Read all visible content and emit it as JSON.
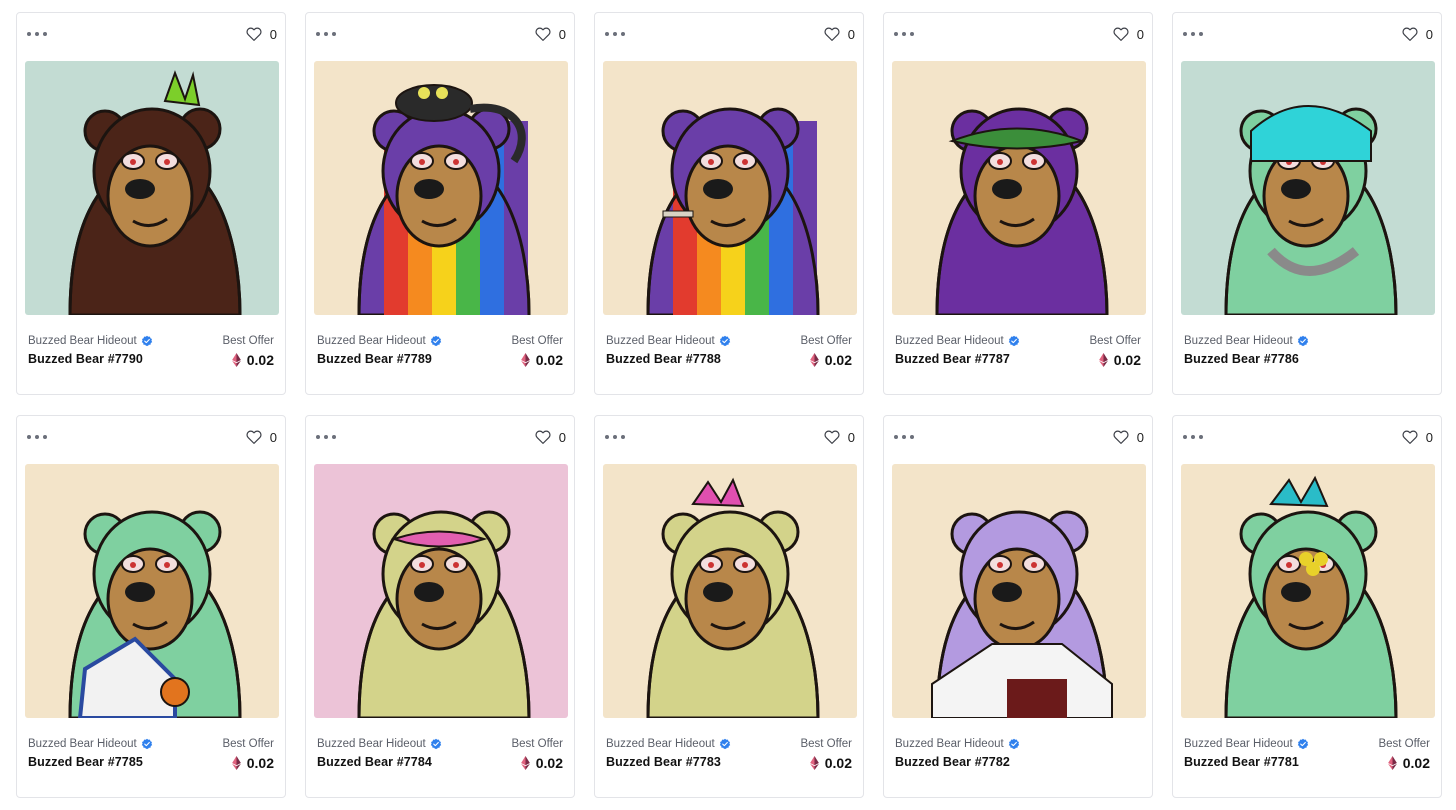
{
  "cards": [
    {
      "collection": "Buzzed Bear Hideout",
      "name": "Buzzed Bear #7790",
      "likes": "0",
      "offer_label": "Best Offer",
      "price": "0.02",
      "bg": "#c3dcd3",
      "fur": "#4b2418",
      "trait": "green-mohawk"
    },
    {
      "collection": "Buzzed Bear Hideout",
      "name": "Buzzed Bear #7789",
      "likes": "0",
      "offer_label": "Best Offer",
      "price": "0.02",
      "bg": "#f3e4c9",
      "fur": "rainbow",
      "trait": "black-cat"
    },
    {
      "collection": "Buzzed Bear Hideout",
      "name": "Buzzed Bear #7788",
      "likes": "0",
      "offer_label": "Best Offer",
      "price": "0.02",
      "bg": "#f3e4c9",
      "fur": "rainbow",
      "trait": "cigarette"
    },
    {
      "collection": "Buzzed Bear Hideout",
      "name": "Buzzed Bear #7787",
      "likes": "0",
      "offer_label": "Best Offer",
      "price": "0.02",
      "bg": "#f3e4c9",
      "fur": "#6b2fa0",
      "trait": "green-visor"
    },
    {
      "collection": "Buzzed Bear Hideout",
      "name": "Buzzed Bear #7786",
      "likes": "0",
      "offer_label": "",
      "price": "",
      "bg": "#c3dcd3",
      "fur": "#7fd0a0",
      "trait": "cyan-hair-chain"
    },
    {
      "collection": "Buzzed Bear Hideout",
      "name": "Buzzed Bear #7785",
      "likes": "0",
      "offer_label": "Best Offer",
      "price": "0.02",
      "bg": "#f3e4c9",
      "fur": "#7fd0a0",
      "trait": "jersey"
    },
    {
      "collection": "Buzzed Bear Hideout",
      "name": "Buzzed Bear #7784",
      "likes": "0",
      "offer_label": "Best Offer",
      "price": "0.02",
      "bg": "#ecc3d7",
      "fur": "#d3d38a",
      "trait": "pink-visor"
    },
    {
      "collection": "Buzzed Bear Hideout",
      "name": "Buzzed Bear #7783",
      "likes": "0",
      "offer_label": "Best Offer",
      "price": "0.02",
      "bg": "#f3e4c9",
      "fur": "#d3d38a",
      "trait": "pink-mohawk"
    },
    {
      "collection": "Buzzed Bear Hideout",
      "name": "Buzzed Bear #7782",
      "likes": "0",
      "offer_label": "",
      "price": "",
      "bg": "#f3e4c9",
      "fur": "#b39ae0",
      "trait": "white-tee"
    },
    {
      "collection": "Buzzed Bear Hideout",
      "name": "Buzzed Bear #7781",
      "likes": "0",
      "offer_label": "Best Offer",
      "price": "0.02",
      "bg": "#f3e4c9",
      "fur": "#7fd0a0",
      "trait": "teal-mohawk"
    }
  ],
  "icons": {
    "more": "more-horizontal-icon",
    "like": "heart-outline-icon",
    "verified": "verified-badge-icon",
    "currency": "ethereum-icon"
  },
  "colors": {
    "verified": "#2f80ed",
    "eth_top": "#e0637f",
    "eth_bottom": "#7a2a46"
  }
}
